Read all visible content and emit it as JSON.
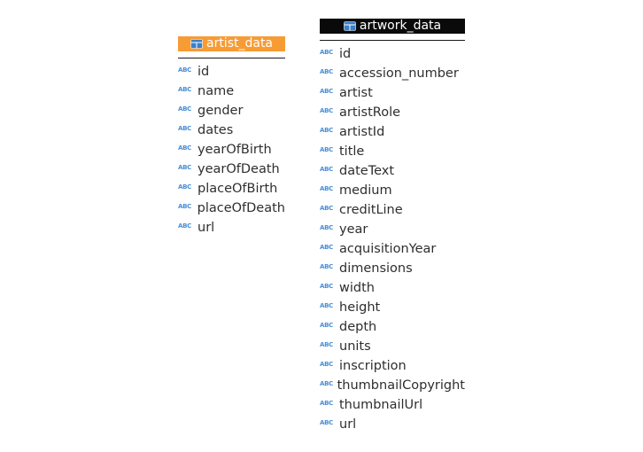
{
  "colors": {
    "artist_header_bg": "#f79b35",
    "artwork_header_bg": "#0a0a0a",
    "type_icon_color": "#4a8fd6",
    "table_icon_color": "#3a7fcc"
  },
  "icons": {
    "table": "table-icon",
    "column_type": "abc-string-type-icon"
  },
  "entities": [
    {
      "name": "artist_data",
      "type_label": "ABC",
      "columns": [
        "id",
        "name",
        "gender",
        "dates",
        "yearOfBirth",
        "yearOfDeath",
        "placeOfBirth",
        "placeOfDeath",
        "url"
      ]
    },
    {
      "name": "artwork_data",
      "type_label": "ABC",
      "columns": [
        "id",
        "accession_number",
        "artist",
        "artistRole",
        "artistId",
        "title",
        "dateText",
        "medium",
        "creditLine",
        "year",
        "acquisitionYear",
        "dimensions",
        "width",
        "height",
        "depth",
        "units",
        "inscription",
        "thumbnailCopyright",
        "thumbnailUrl",
        "url"
      ]
    }
  ]
}
